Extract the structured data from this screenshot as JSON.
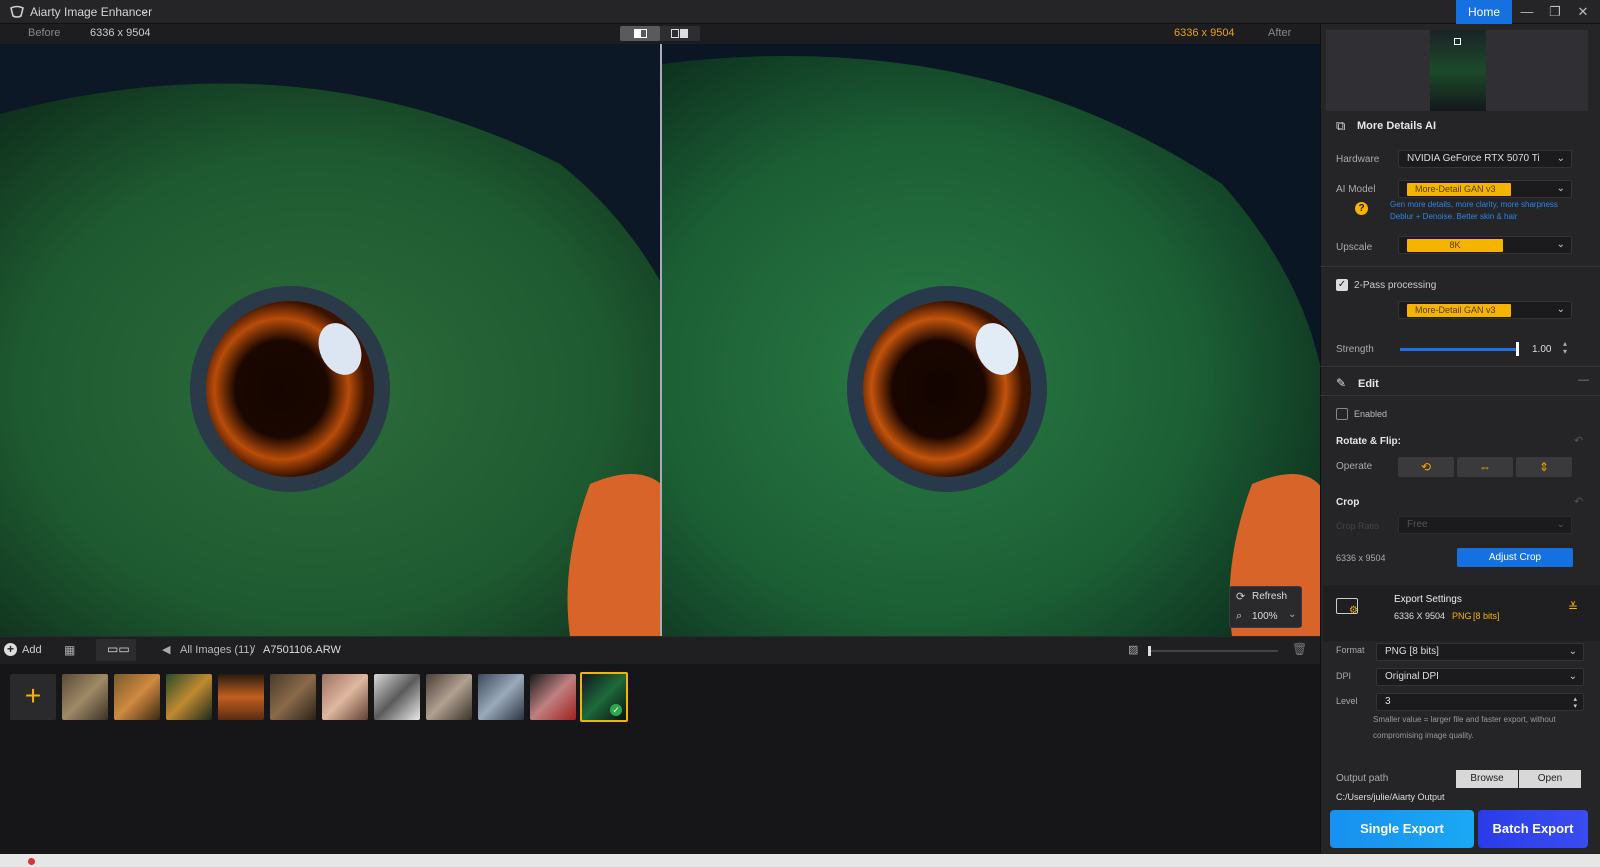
{
  "app": {
    "title": "Aiarty Image Enhancer",
    "home_label": "Home"
  },
  "compare": {
    "before_label": "Before",
    "before_size": "6336 x 9504",
    "after_label": "After",
    "after_size": "6336 x 9504"
  },
  "viewer": {
    "refresh_label": "Refresh",
    "zoom": "100%"
  },
  "bottombar": {
    "add_label": "Add",
    "breadcrumb_root": "All Images (11)",
    "breadcrumb_sep": "/",
    "breadcrumb_file": "A7501106.ARW"
  },
  "thumbnails": {
    "count": 11,
    "selected_index": 10
  },
  "panel": {
    "section_title": "More Details AI",
    "hardware": {
      "label": "Hardware",
      "value": "NVIDIA GeForce RTX 5070 Ti"
    },
    "ai_model": {
      "label": "AI Model",
      "value": "More-Detail GAN  v3",
      "hint_line1": "Gen more details, more clarity, more sharpness",
      "hint_line2": "Deblur + Denoise. Better skin & hair"
    },
    "upscale": {
      "label": "Upscale",
      "value": "8K"
    },
    "two_pass": {
      "label": "2-Pass processing",
      "checked": true,
      "model": "More-Detail GAN  v3"
    },
    "strength": {
      "label": "Strength",
      "value": "1.00",
      "level": 1.0
    },
    "edit": {
      "title": "Edit",
      "enabled_label": "Enabled",
      "enabled": false
    },
    "rotate": {
      "title": "Rotate & Flip:",
      "operate_label": "Operate"
    },
    "crop": {
      "title": "Crop",
      "ratio_label": "Crop Ratio",
      "ratio_value": "Free",
      "size": "6336 x 9504",
      "adjust_label": "Adjust Crop"
    },
    "export": {
      "title": "Export Settings",
      "size": "6336 X 9504",
      "format_short": "PNG",
      "bits": "[8 bits]",
      "format_label": "Format",
      "format_value": "PNG  [8 bits]",
      "dpi_label": "DPI",
      "dpi_value": "Original DPI",
      "level_label": "Level",
      "level_value": "3",
      "level_note_1": "Smaller value = larger file and faster export, without",
      "level_note_2": "compromising image quality.",
      "output_label": "Output path",
      "browse_label": "Browse",
      "open_label": "Open",
      "output_path": "C:/Users/julie/Aiarty Output",
      "single_label": "Single Export",
      "batch_label": "Batch Export"
    }
  },
  "colors": {
    "accent": "#1570e0",
    "highlight": "#f5b400",
    "size_text": "#e8a020"
  }
}
